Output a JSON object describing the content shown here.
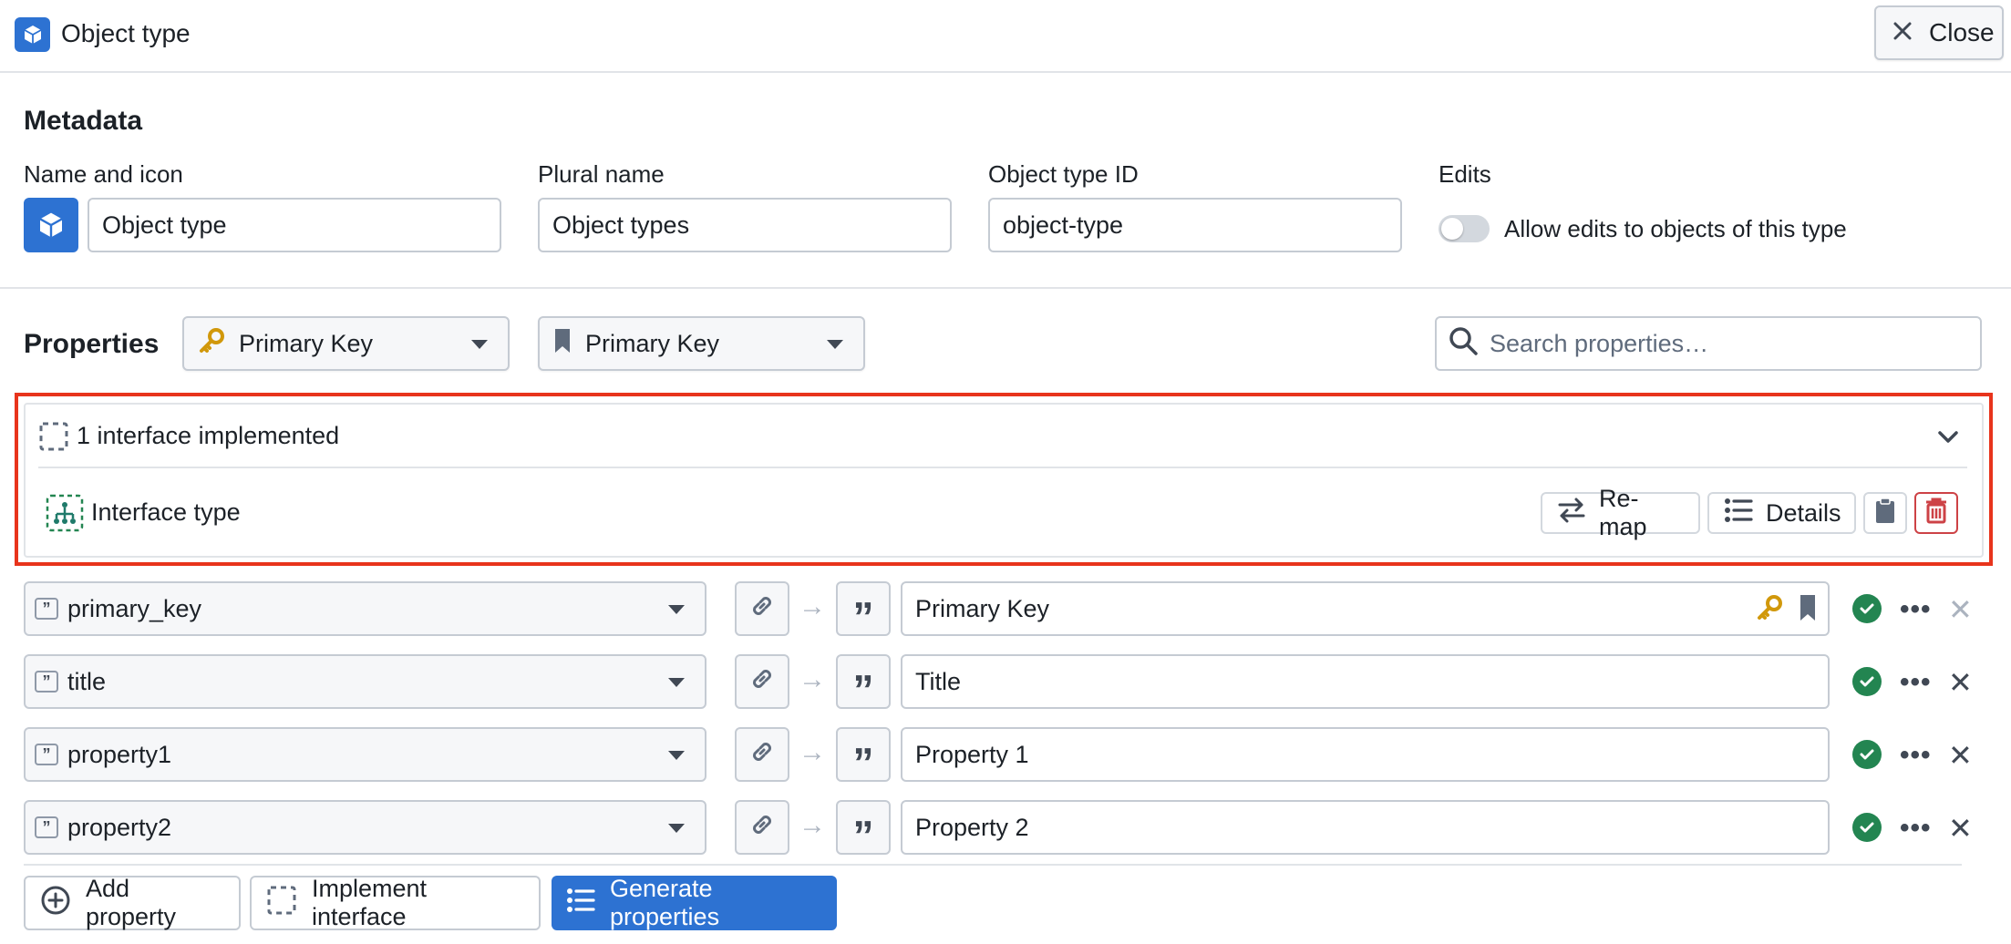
{
  "header": {
    "title": "Object type",
    "close_label": "Close"
  },
  "metadata": {
    "section_title": "Metadata",
    "name_label": "Name and icon",
    "name_value": "Object type",
    "plural_label": "Plural name",
    "plural_value": "Object types",
    "id_label": "Object type ID",
    "id_value": "object-type",
    "edits_label": "Edits",
    "edits_toggle_label": "Allow edits to objects of this type",
    "edits_enabled": false
  },
  "properties": {
    "section_title": "Properties",
    "primary_key_select": "Primary Key",
    "title_key_select": "Primary Key",
    "search_placeholder": "Search properties…"
  },
  "interfaces": {
    "summary": "1 interface implemented",
    "items": [
      {
        "name": "Interface type",
        "remap_label": "Re-map",
        "details_label": "Details"
      }
    ]
  },
  "property_rows": [
    {
      "source": "primary_key",
      "display": "Primary Key",
      "is_primary_key": true,
      "is_title": true
    },
    {
      "source": "title",
      "display": "Title",
      "is_primary_key": false,
      "is_title": false
    },
    {
      "source": "property1",
      "display": "Property 1",
      "is_primary_key": false,
      "is_title": false
    },
    {
      "source": "property2",
      "display": "Property 2",
      "is_primary_key": false,
      "is_title": false
    }
  ],
  "footer": {
    "add_property": "Add property",
    "implement_interface": "Implement interface",
    "generate_properties": "Generate properties"
  },
  "colors": {
    "accent": "#2d72d2",
    "success": "#238551",
    "danger": "#cd4246",
    "key_gold": "#d1980b",
    "highlight_border": "#e8341c"
  },
  "icons": {
    "app": "cube-icon",
    "close": "close-icon",
    "primary_key": "key-icon",
    "title_key": "bookmark-icon",
    "search": "search-icon",
    "interface": "dashed-square-icon",
    "interface_type": "hierarchy-icon",
    "remap": "swap-arrows-icon",
    "details": "list-icon",
    "clipboard": "clipboard-icon",
    "delete": "trash-icon",
    "string_type": "quote-icon",
    "link": "link-icon",
    "valid": "check-circle-icon",
    "more": "more-icon",
    "remove": "x-icon",
    "add": "plus-circle-icon",
    "generate": "list-icon"
  }
}
